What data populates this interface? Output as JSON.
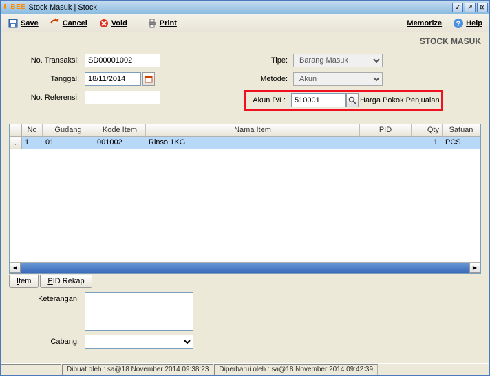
{
  "window": {
    "title": "Stock Masuk | Stock",
    "logo": "BEE"
  },
  "toolbar": {
    "save": "Save",
    "cancel": "Cancel",
    "void": "Void",
    "print": "Print",
    "memorize": "Memorize",
    "help": "Help"
  },
  "header": "STOCK MASUK",
  "form": {
    "no_transaksi_label": "No. Transaksi:",
    "no_transaksi": "SD00001002",
    "tanggal_label": "Tanggal:",
    "tanggal": "18/11/2014",
    "no_referensi_label": "No. Referensi:",
    "no_referensi": "",
    "tipe_label": "Tipe:",
    "tipe": "Barang Masuk",
    "metode_label": "Metode:",
    "metode": "Akun",
    "akun_pl_label": "Akun P/L:",
    "akun_pl": "510001",
    "akun_pl_desc": "Harga Pokok Penjualan"
  },
  "table": {
    "headers": {
      "no": "No",
      "gudang": "Gudang",
      "kode": "Kode Item",
      "nama": "Nama Item",
      "pid": "PID",
      "qty": "Qty",
      "satuan": "Satuan"
    },
    "rows": [
      {
        "no": "1",
        "gudang": "01",
        "kode": "001002",
        "nama": "Rinso 1KG",
        "pid": "",
        "qty": "1",
        "satuan": "PCS"
      }
    ]
  },
  "tabs": {
    "item": "tem",
    "item_ul": "I",
    "pid": "ID Rekap",
    "pid_ul": "P"
  },
  "bottom": {
    "keterangan_label": "Keterangan:",
    "keterangan": "",
    "cabang_label": "Cabang:",
    "cabang": ""
  },
  "status": {
    "created": "Dibuat oleh : sa@18 November 2014  09:38:23",
    "updated": "Diperbarui oleh : sa@18 November 2014  09:42:39"
  }
}
